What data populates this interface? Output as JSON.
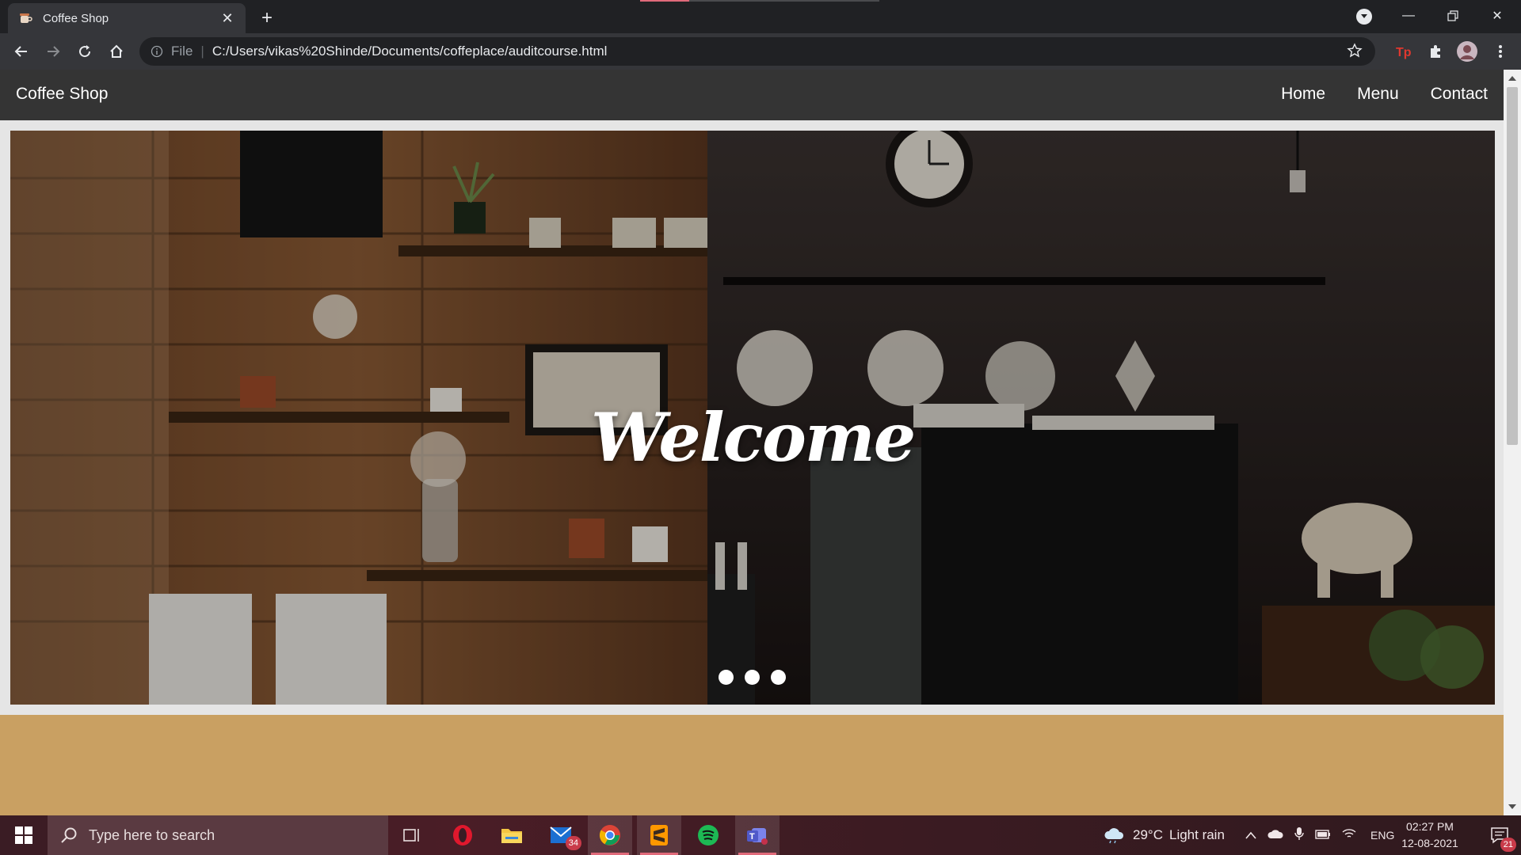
{
  "browser": {
    "tab_title": "Coffee Shop",
    "url_scheme": "File",
    "url_separator": "|",
    "url": "C:/Users/vikas%20Shinde/Documents/coffeplace/auditcourse.html",
    "window_buttons": [
      "minimize-icon",
      "restore-icon",
      "close-icon"
    ],
    "nav_buttons": [
      "back-icon",
      "forward-icon",
      "reload-icon",
      "home-icon"
    ],
    "extensions": [
      "tp-extension-icon",
      "puzzle-icon",
      "avatar",
      "kebab-menu-icon"
    ],
    "colors": {
      "tab_strip": "#202124",
      "toolbar": "#35363a",
      "loading_accent": "#e06a7a"
    }
  },
  "site": {
    "brand": "Coffee Shop",
    "nav": [
      {
        "label": "Home"
      },
      {
        "label": "Menu"
      },
      {
        "label": "Contact"
      }
    ],
    "hero": {
      "heading": "Welcome",
      "carousel_slide_count": 3
    },
    "colors": {
      "navbar": "#343434",
      "section": "#c9a062",
      "page_bg": "#e5e5e5"
    }
  },
  "taskbar": {
    "search_placeholder": "Type here to search",
    "apps": [
      {
        "name": "task-view-icon"
      },
      {
        "name": "opera-icon"
      },
      {
        "name": "file-explorer-icon"
      },
      {
        "name": "mail-icon",
        "badge": "34"
      },
      {
        "name": "chrome-icon",
        "active": true
      },
      {
        "name": "sublime-text-icon",
        "active": true
      },
      {
        "name": "spotify-icon"
      },
      {
        "name": "teams-icon",
        "active": true
      }
    ],
    "weather": {
      "temp": "29°C",
      "condition": "Light rain"
    },
    "language": "ENG",
    "time": "02:27 PM",
    "date": "12-08-2021",
    "notification_count": "21"
  }
}
